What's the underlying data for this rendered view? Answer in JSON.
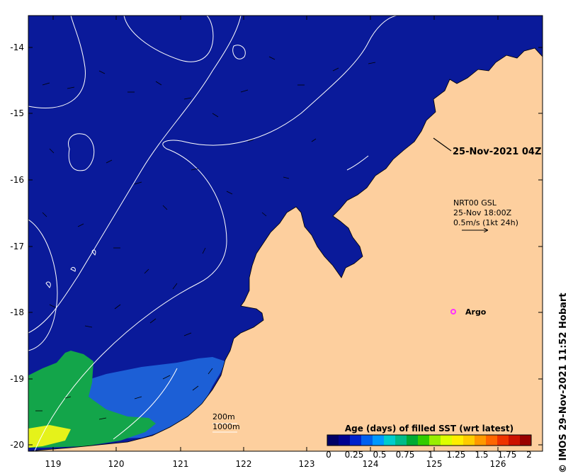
{
  "map": {
    "colors": {
      "land": "#fdcf9e",
      "ocean_fresh": "#0a1a9a",
      "age_quarter": "#1c5fd6",
      "age_one": "#13a54a",
      "age_yellow": "#e5f21a",
      "contours": "#ffffff",
      "argo": "#ff33ff"
    },
    "y_ticks": [
      "-14",
      "-15",
      "-16",
      "-17",
      "-18",
      "-19",
      "-20"
    ],
    "x_ticks": [
      "119",
      "120",
      "121",
      "122",
      "123",
      "124",
      "125",
      "126"
    ],
    "timestamp": "25-Nov-2021 04Z",
    "current_legend": {
      "line1": "NRT00 GSL",
      "line2": "25-Nov 18:00Z",
      "line3": "0.5m/s (1kt 24h)"
    },
    "argo_label": "Argo",
    "scale": {
      "a": "200m",
      "b": "1000m"
    },
    "colorbar": {
      "title": "Age (days) of filled SST (wrt latest)",
      "ticks": [
        "0",
        "0.25",
        "0.5",
        "0.75",
        "1",
        "1.25",
        "1.5",
        "1.75",
        "2"
      ],
      "colors": [
        "#000066",
        "#00008f",
        "#0022cc",
        "#0060ee",
        "#0099ff",
        "#00cccc",
        "#00bb88",
        "#00aa33",
        "#33cc00",
        "#99ee00",
        "#ddff00",
        "#ffee00",
        "#ffcc00",
        "#ff9900",
        "#ff6600",
        "#ee3300",
        "#cc1100",
        "#990000"
      ]
    },
    "credit": "© IMOS 29-Nov-2021 11:52 Hobart"
  }
}
